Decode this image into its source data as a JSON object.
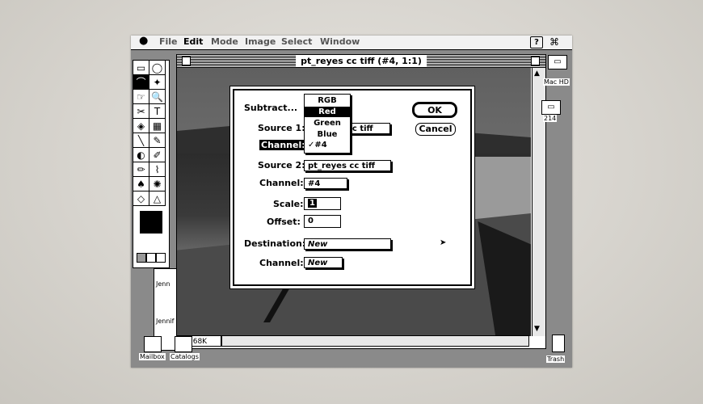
{
  "menubar": {
    "apple": "",
    "items": [
      "File",
      "Edit",
      "Mode",
      "Image",
      "Select",
      "Window"
    ],
    "help_icon": "?",
    "app_icon": "⌘"
  },
  "toolbox": {
    "tools": [
      "▭",
      "◯",
      "⌒",
      "✦",
      "☞",
      "🔍",
      "✂",
      "T",
      "◈",
      "▦",
      "╲",
      "✎",
      "◐",
      "✐",
      "✏",
      "⌇",
      "♠",
      "✺",
      "◇",
      "△"
    ]
  },
  "document": {
    "title": "pt_reyes cc tiff (#4, 1:1)",
    "size": "768K"
  },
  "dialog": {
    "subtract_label": "Subtract...",
    "source1_label": "Source 1:",
    "source1_value": "cc tiff",
    "channel1_label": "Channel:",
    "source2_label": "Source 2:",
    "source2_value": "pt_reyes cc tiff",
    "channel2_label": "Channel:",
    "channel2_value": "#4",
    "scale_label": "Scale:",
    "scale_value": "1",
    "offset_label": "Offset:",
    "offset_value": "0",
    "destination_label": "Destination:",
    "destination_value": "New",
    "channel3_label": "Channel:",
    "channel3_value": "New",
    "ok": "OK",
    "cancel": "Cancel",
    "popup_items": [
      "RGB",
      "Red",
      "Green",
      "Blue",
      "✓#4"
    ]
  },
  "desktop": {
    "mac_hd": "Mac HD",
    "disk_num": "214",
    "mailbox": "Mailbox",
    "catalogs": "Catalogs",
    "trash": "Trash",
    "jennif1": "Jenn",
    "jennif2": "Jennif"
  }
}
